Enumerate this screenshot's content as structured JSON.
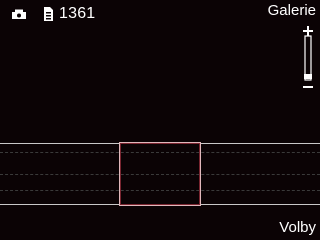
{
  "status": {
    "mode_icon": "camera-mode-icon",
    "card_icon": "memory-card-icon",
    "shots_remaining": "1361"
  },
  "softkeys": {
    "left": "Galerie",
    "right": "Volby"
  },
  "zoom": {
    "icon": "zoom-slider-icon",
    "level": 0
  },
  "colors": {
    "background": "#0b0305",
    "highlight_border": "#e0b8bc",
    "highlight_inner": "#7a2530"
  }
}
